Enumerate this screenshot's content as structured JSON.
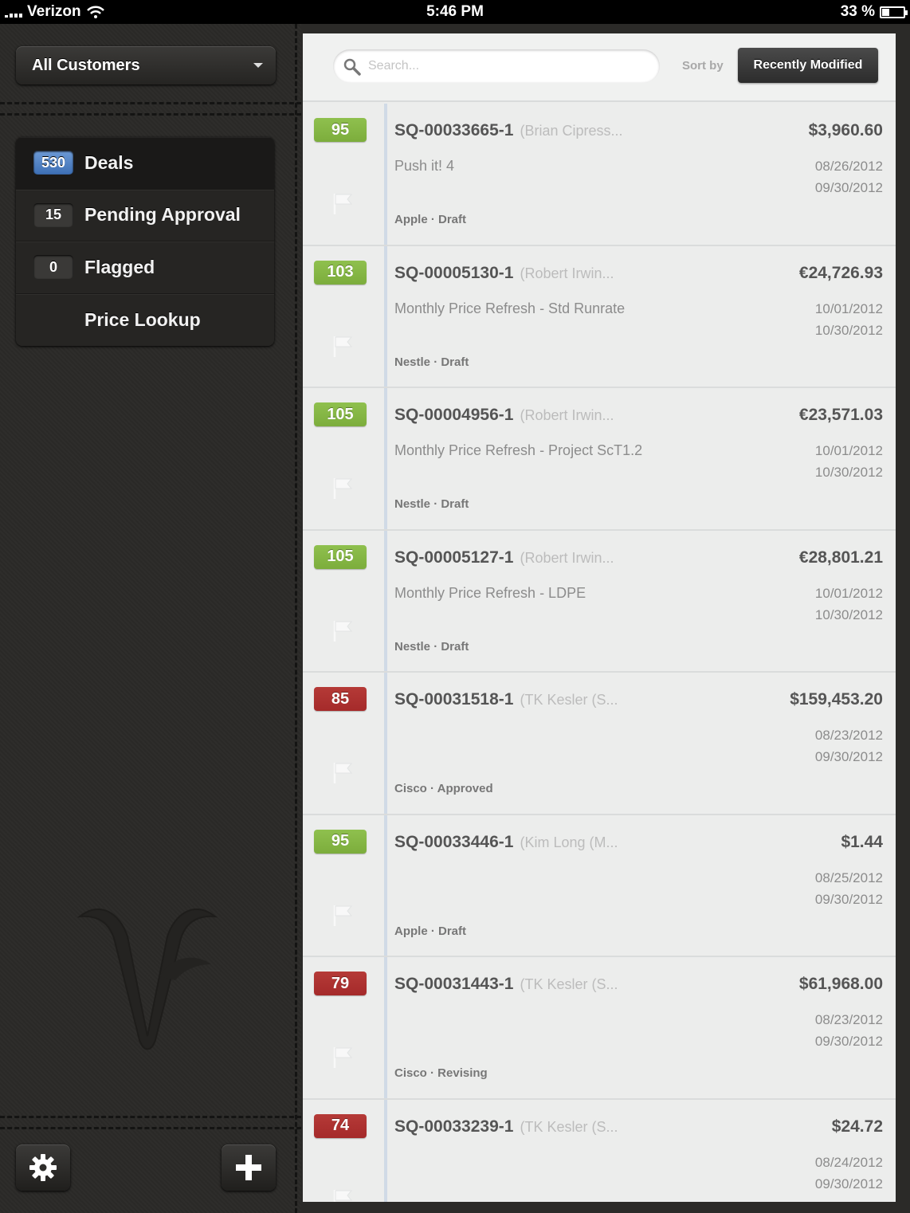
{
  "status_bar": {
    "carrier": "Verizon",
    "time": "5:46 PM",
    "battery": "33 %"
  },
  "sidebar": {
    "customer_filter": "All Customers",
    "nav": [
      {
        "badge": "530",
        "label": "Deals",
        "active": true
      },
      {
        "badge": "15",
        "label": "Pending Approval",
        "active": false
      },
      {
        "badge": "0",
        "label": "Flagged",
        "active": false
      },
      {
        "badge": "",
        "label": "Price Lookup",
        "active": false
      }
    ],
    "settings_icon": "gear-icon",
    "add_icon": "plus-icon"
  },
  "toolbar": {
    "search_placeholder": "Search...",
    "sort_label": "Sort by",
    "sort_value": "Recently Modified"
  },
  "colors": {
    "score_green": "#7cad3c",
    "score_red": "#a52a2a",
    "badge_blue": "#4b7fc3"
  },
  "deals": [
    {
      "score": "95",
      "score_color": "green",
      "id": "SQ-00033665-1",
      "owner": "(Brian Cipress...",
      "amount": "$3,960.60",
      "description": "Push it! 4",
      "date_start": "08/26/2012",
      "date_end": "09/30/2012",
      "meta": "Apple · Draft"
    },
    {
      "score": "103",
      "score_color": "green",
      "id": "SQ-00005130-1",
      "owner": "(Robert Irwin...",
      "amount": "€24,726.93",
      "description": "Monthly Price Refresh - Std Runrate",
      "date_start": "10/01/2012",
      "date_end": "10/30/2012",
      "meta": "Nestle · Draft"
    },
    {
      "score": "105",
      "score_color": "green",
      "id": "SQ-00004956-1",
      "owner": "(Robert Irwin...",
      "amount": "€23,571.03",
      "description": "Monthly Price Refresh - Project ScT1.2",
      "date_start": "10/01/2012",
      "date_end": "10/30/2012",
      "meta": "Nestle · Draft"
    },
    {
      "score": "105",
      "score_color": "green",
      "id": "SQ-00005127-1",
      "owner": "(Robert Irwin...",
      "amount": "€28,801.21",
      "description": "Monthly Price Refresh - LDPE",
      "date_start": "10/01/2012",
      "date_end": "10/30/2012",
      "meta": "Nestle · Draft"
    },
    {
      "score": "85",
      "score_color": "red",
      "id": "SQ-00031518-1",
      "owner": "(TK Kesler (S...",
      "amount": "$159,453.20",
      "description": "",
      "date_start": "08/23/2012",
      "date_end": "09/30/2012",
      "meta": "Cisco · Approved"
    },
    {
      "score": "95",
      "score_color": "green",
      "id": "SQ-00033446-1",
      "owner": "(Kim Long (M...",
      "amount": "$1.44",
      "description": "",
      "date_start": "08/25/2012",
      "date_end": "09/30/2012",
      "meta": "Apple · Draft"
    },
    {
      "score": "79",
      "score_color": "red",
      "id": "SQ-00031443-1",
      "owner": "(TK Kesler (S...",
      "amount": "$61,968.00",
      "description": "",
      "date_start": "08/23/2012",
      "date_end": "09/30/2012",
      "meta": "Cisco · Revising"
    },
    {
      "score": "74",
      "score_color": "red",
      "id": "SQ-00033239-1",
      "owner": "(TK Kesler (S...",
      "amount": "$24.72",
      "description": "",
      "date_start": "08/24/2012",
      "date_end": "09/30/2012",
      "meta": ""
    }
  ]
}
